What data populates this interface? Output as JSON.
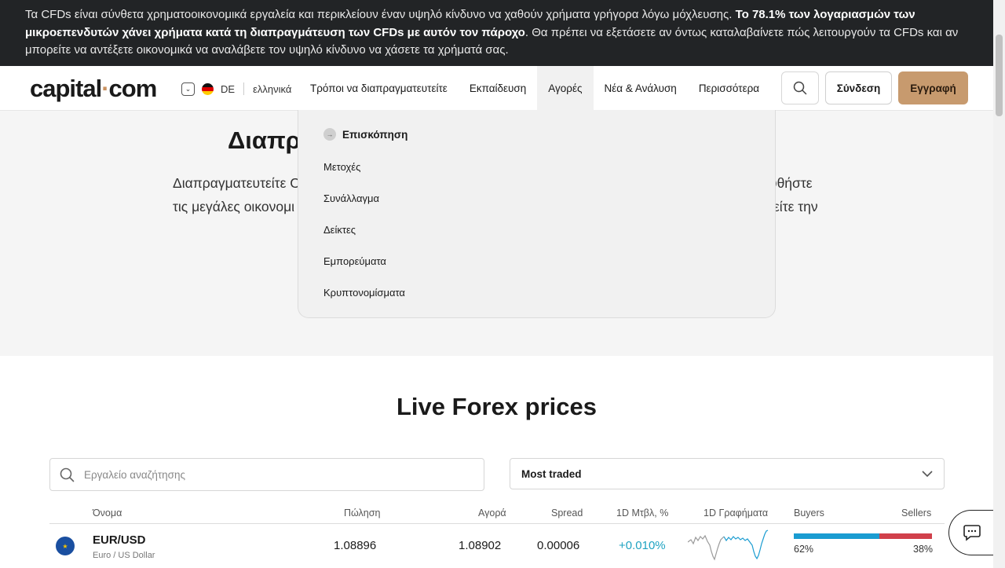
{
  "risk_banner": {
    "part1": "Τα CFDs είναι σύνθετα χρηματοοικονομικά εργαλεία και περικλείουν έναν υψηλό κίνδυνο να χαθούν χρήματα γρήγορα λόγω μόχλευσης. ",
    "bold": "Το 78.1% των λογαριασμών των μικροεπενδυτών χάνει χρήματα κατά τη διαπραγμάτευση των CFDs με αυτόν τον πάροχο",
    "part2": ". Θα πρέπει να εξετάσετε αν όντως καταλαβαίνετε πώς λειτουργούν τα CFDs και αν μπορείτε να αντέξετε οικονομικά να αναλάβετε τον υψηλό κίνδυνο να χάσετε τα χρήματά σας."
  },
  "header": {
    "logo_left": "capital",
    "logo_dot": "·",
    "logo_right": "com",
    "lang_code": "DE",
    "lang_name": "ελληνικά",
    "nav": [
      {
        "label": "Τρόποι να διαπραγματευτείτε"
      },
      {
        "label": "Εκπαίδευση"
      },
      {
        "label": "Αγορές"
      },
      {
        "label": "Νέα & Ανάλυση"
      },
      {
        "label": "Περισσότερα"
      }
    ],
    "login": "Σύνδεση",
    "signup": "Εγγραφή"
  },
  "hero": {
    "title": "Διαπρ",
    "line1_start": "Διαπραγματευτείτε C",
    "line1_end": "υθήστε",
    "line2_start": "τις μεγάλες οικονομι",
    "line2_end": "είτε την"
  },
  "markets_menu": {
    "overview": "Επισκόπηση",
    "items": [
      "Μετοχές",
      "Συνάλλαγμα",
      "Δείκτες",
      "Εμπορεύματα",
      "Κρυπτονομίσματα"
    ]
  },
  "forex": {
    "title": "Live Forex prices",
    "search_placeholder": "Εργαλείο αναζήτησης",
    "sort_selected": "Most traded",
    "columns": {
      "name": "Όνομα",
      "sell": "Πώληση",
      "buy": "Αγορά",
      "spread": "Spread",
      "change": "1D Μτβλ, %",
      "chart": "1D Γραφήματα",
      "buyers": "Buyers",
      "sellers": "Sellers"
    },
    "rows": [
      {
        "name": "EUR/USD",
        "subtitle": "Euro / US Dollar",
        "sell": "1.08896",
        "buy": "1.08902",
        "spread": "0.00006",
        "change": "+0.010%",
        "buyers_pct": "62%",
        "sellers_pct": "38%",
        "buyers_value": 62,
        "sellers_value": 38
      }
    ]
  },
  "colors": {
    "banner_bg": "#222426",
    "accent": "#c79a6e",
    "positive": "#1fa3c2",
    "buyers_bar": "#1a9cd1",
    "sellers_bar": "#d0404b"
  }
}
